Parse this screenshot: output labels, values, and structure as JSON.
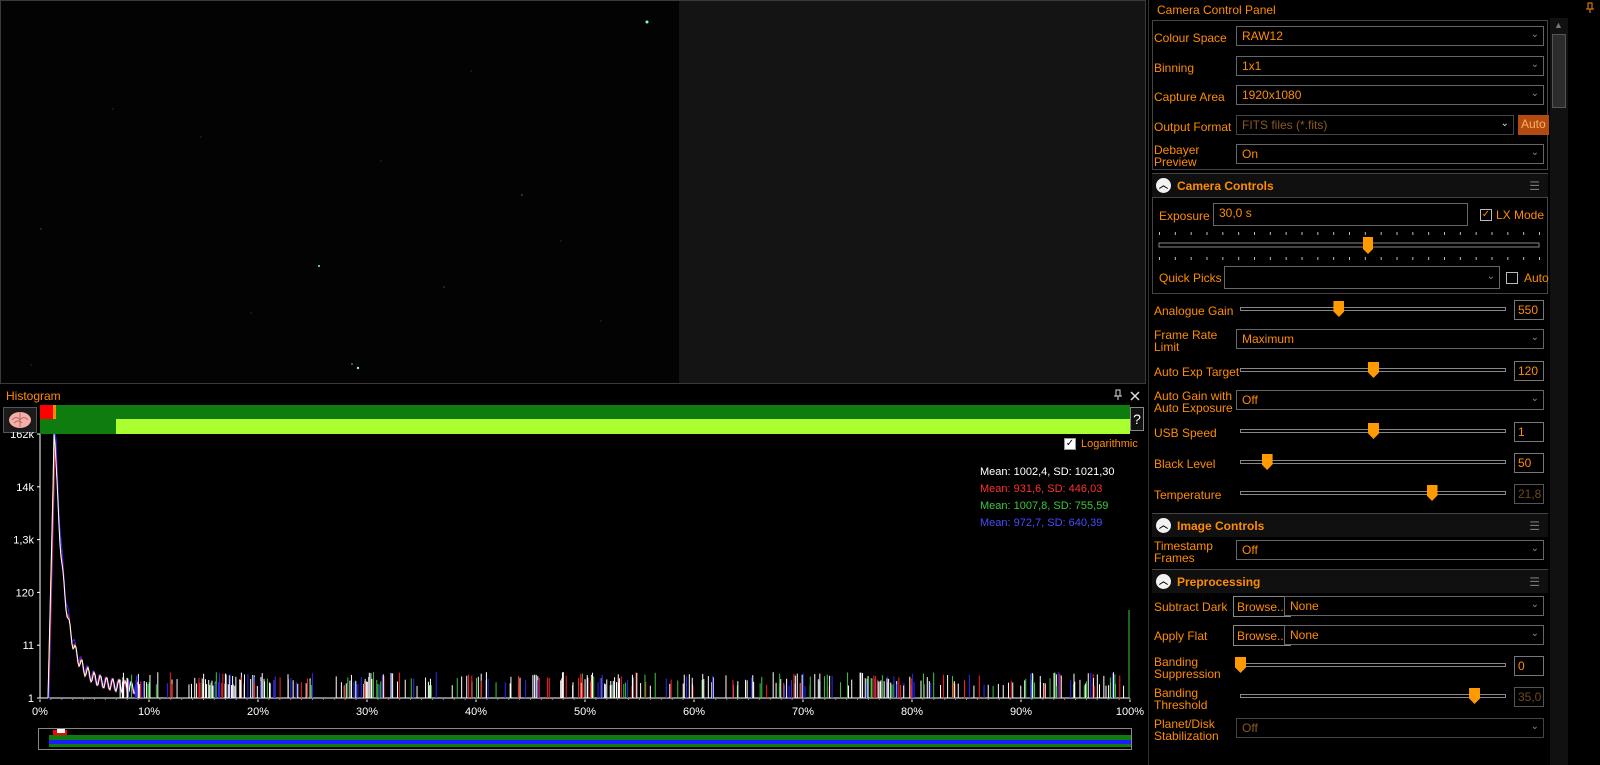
{
  "histogram": {
    "title": "Histogram",
    "pin_icon": "pin-icon",
    "close_icon": "close-icon",
    "help_label": "?",
    "logarithmic_label": "Logarithmic",
    "logarithmic_checked": true,
    "y_ticks": [
      "162k",
      "14k",
      "1,3k",
      "120",
      "11",
      "1"
    ],
    "x_ticks": [
      "0%",
      "10%",
      "20%",
      "30%",
      "40%",
      "50%",
      "60%",
      "70%",
      "80%",
      "90%",
      "100%"
    ],
    "stats": [
      {
        "text": "Mean: 1002,4, SD: 1021,30",
        "color": "#ffffff"
      },
      {
        "text": "Mean: 931,6, SD: 446,03",
        "color": "#ff3030"
      },
      {
        "text": "Mean: 1007,8, SD: 755,59",
        "color": "#3cc83c"
      },
      {
        "text": "Mean: 972,7, SD: 640,39",
        "color": "#4a4aff"
      }
    ]
  },
  "panel": {
    "title": "Camera Control Panel",
    "colour_space": {
      "label": "Colour Space",
      "value": "RAW12"
    },
    "binning": {
      "label": "Binning",
      "value": "1x1"
    },
    "capture_area": {
      "label": "Capture Area",
      "value": "1920x1080"
    },
    "output_format": {
      "label": "Output Format",
      "value": "FITS files (*.fits)",
      "auto_label": "Auto"
    },
    "debayer": {
      "label_line1": "Debayer",
      "label_line2": "Preview",
      "value": "On"
    },
    "camera_controls": {
      "title": "Camera Controls",
      "exposure_label": "Exposure",
      "exposure_value": "30,0 s",
      "lx_mode_label": "LX Mode",
      "lx_mode_checked": true,
      "exposure_slider": 0.55,
      "quick_picks_label": "Quick Picks",
      "quick_picks_value": "",
      "auto_label": "Auto",
      "auto_checked": false
    },
    "analogue_gain": {
      "label": "Analogue Gain",
      "value": "550",
      "level": 0.37
    },
    "frame_rate": {
      "label_line1": "Frame Rate",
      "label_line2": "Limit",
      "value": "Maximum"
    },
    "auto_exp_target": {
      "label": "Auto Exp Target",
      "value": "120",
      "level": 0.5
    },
    "auto_gain": {
      "label_line1": "Auto Gain with",
      "label_line2": "Auto Exposure",
      "value": "Off"
    },
    "usb_speed": {
      "label": "USB Speed",
      "value": "1",
      "level": 0.5
    },
    "black_level": {
      "label": "Black Level",
      "value": "50",
      "level": 0.1
    },
    "temperature": {
      "label": "Temperature",
      "value": "21,8",
      "level": 0.72
    },
    "image_controls": {
      "title": "Image Controls"
    },
    "timestamp": {
      "label_line1": "Timestamp",
      "label_line2": "Frames",
      "value": "Off"
    },
    "preprocessing": {
      "title": "Preprocessing"
    },
    "subtract_dark": {
      "label": "Subtract Dark",
      "browse_label": "Browse...",
      "value": "None"
    },
    "apply_flat": {
      "label": "Apply Flat",
      "browse_label": "Browse...",
      "value": "None"
    },
    "banding_suppression": {
      "label_line1": "Banding",
      "label_line2": "Suppression",
      "value": "0",
      "level": 0.0
    },
    "banding_threshold": {
      "label_line1": "Banding",
      "label_line2": "Threshold",
      "value": "35,0",
      "level": 0.88
    },
    "planet_disk": {
      "label_line1": "Planet/Disk",
      "label_line2": "Stabilization",
      "value": "Off"
    }
  }
}
